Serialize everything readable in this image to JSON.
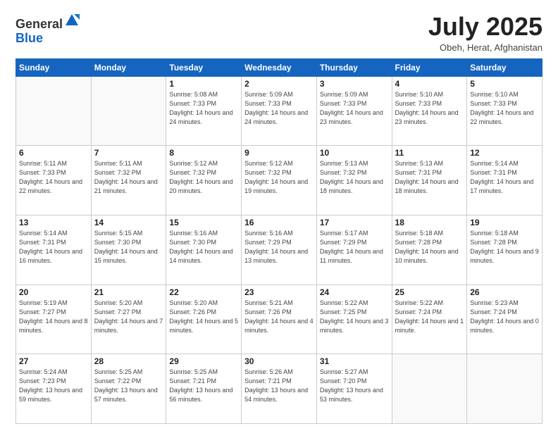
{
  "logo": {
    "general": "General",
    "blue": "Blue"
  },
  "title": "July 2025",
  "location": "Obeh, Herat, Afghanistan",
  "days_of_week": [
    "Sunday",
    "Monday",
    "Tuesday",
    "Wednesday",
    "Thursday",
    "Friday",
    "Saturday"
  ],
  "weeks": [
    [
      {
        "day": "",
        "sunrise": "",
        "sunset": "",
        "daylight": ""
      },
      {
        "day": "",
        "sunrise": "",
        "sunset": "",
        "daylight": ""
      },
      {
        "day": "1",
        "sunrise": "Sunrise: 5:08 AM",
        "sunset": "Sunset: 7:33 PM",
        "daylight": "Daylight: 14 hours and 24 minutes."
      },
      {
        "day": "2",
        "sunrise": "Sunrise: 5:09 AM",
        "sunset": "Sunset: 7:33 PM",
        "daylight": "Daylight: 14 hours and 24 minutes."
      },
      {
        "day": "3",
        "sunrise": "Sunrise: 5:09 AM",
        "sunset": "Sunset: 7:33 PM",
        "daylight": "Daylight: 14 hours and 23 minutes."
      },
      {
        "day": "4",
        "sunrise": "Sunrise: 5:10 AM",
        "sunset": "Sunset: 7:33 PM",
        "daylight": "Daylight: 14 hours and 23 minutes."
      },
      {
        "day": "5",
        "sunrise": "Sunrise: 5:10 AM",
        "sunset": "Sunset: 7:33 PM",
        "daylight": "Daylight: 14 hours and 22 minutes."
      }
    ],
    [
      {
        "day": "6",
        "sunrise": "Sunrise: 5:11 AM",
        "sunset": "Sunset: 7:33 PM",
        "daylight": "Daylight: 14 hours and 22 minutes."
      },
      {
        "day": "7",
        "sunrise": "Sunrise: 5:11 AM",
        "sunset": "Sunset: 7:32 PM",
        "daylight": "Daylight: 14 hours and 21 minutes."
      },
      {
        "day": "8",
        "sunrise": "Sunrise: 5:12 AM",
        "sunset": "Sunset: 7:32 PM",
        "daylight": "Daylight: 14 hours and 20 minutes."
      },
      {
        "day": "9",
        "sunrise": "Sunrise: 5:12 AM",
        "sunset": "Sunset: 7:32 PM",
        "daylight": "Daylight: 14 hours and 19 minutes."
      },
      {
        "day": "10",
        "sunrise": "Sunrise: 5:13 AM",
        "sunset": "Sunset: 7:32 PM",
        "daylight": "Daylight: 14 hours and 18 minutes."
      },
      {
        "day": "11",
        "sunrise": "Sunrise: 5:13 AM",
        "sunset": "Sunset: 7:31 PM",
        "daylight": "Daylight: 14 hours and 18 minutes."
      },
      {
        "day": "12",
        "sunrise": "Sunrise: 5:14 AM",
        "sunset": "Sunset: 7:31 PM",
        "daylight": "Daylight: 14 hours and 17 minutes."
      }
    ],
    [
      {
        "day": "13",
        "sunrise": "Sunrise: 5:14 AM",
        "sunset": "Sunset: 7:31 PM",
        "daylight": "Daylight: 14 hours and 16 minutes."
      },
      {
        "day": "14",
        "sunrise": "Sunrise: 5:15 AM",
        "sunset": "Sunset: 7:30 PM",
        "daylight": "Daylight: 14 hours and 15 minutes."
      },
      {
        "day": "15",
        "sunrise": "Sunrise: 5:16 AM",
        "sunset": "Sunset: 7:30 PM",
        "daylight": "Daylight: 14 hours and 14 minutes."
      },
      {
        "day": "16",
        "sunrise": "Sunrise: 5:16 AM",
        "sunset": "Sunset: 7:29 PM",
        "daylight": "Daylight: 14 hours and 13 minutes."
      },
      {
        "day": "17",
        "sunrise": "Sunrise: 5:17 AM",
        "sunset": "Sunset: 7:29 PM",
        "daylight": "Daylight: 14 hours and 11 minutes."
      },
      {
        "day": "18",
        "sunrise": "Sunrise: 5:18 AM",
        "sunset": "Sunset: 7:28 PM",
        "daylight": "Daylight: 14 hours and 10 minutes."
      },
      {
        "day": "19",
        "sunrise": "Sunrise: 5:18 AM",
        "sunset": "Sunset: 7:28 PM",
        "daylight": "Daylight: 14 hours and 9 minutes."
      }
    ],
    [
      {
        "day": "20",
        "sunrise": "Sunrise: 5:19 AM",
        "sunset": "Sunset: 7:27 PM",
        "daylight": "Daylight: 14 hours and 8 minutes."
      },
      {
        "day": "21",
        "sunrise": "Sunrise: 5:20 AM",
        "sunset": "Sunset: 7:27 PM",
        "daylight": "Daylight: 14 hours and 7 minutes."
      },
      {
        "day": "22",
        "sunrise": "Sunrise: 5:20 AM",
        "sunset": "Sunset: 7:26 PM",
        "daylight": "Daylight: 14 hours and 5 minutes."
      },
      {
        "day": "23",
        "sunrise": "Sunrise: 5:21 AM",
        "sunset": "Sunset: 7:26 PM",
        "daylight": "Daylight: 14 hours and 4 minutes."
      },
      {
        "day": "24",
        "sunrise": "Sunrise: 5:22 AM",
        "sunset": "Sunset: 7:25 PM",
        "daylight": "Daylight: 14 hours and 3 minutes."
      },
      {
        "day": "25",
        "sunrise": "Sunrise: 5:22 AM",
        "sunset": "Sunset: 7:24 PM",
        "daylight": "Daylight: 14 hours and 1 minute."
      },
      {
        "day": "26",
        "sunrise": "Sunrise: 5:23 AM",
        "sunset": "Sunset: 7:24 PM",
        "daylight": "Daylight: 14 hours and 0 minutes."
      }
    ],
    [
      {
        "day": "27",
        "sunrise": "Sunrise: 5:24 AM",
        "sunset": "Sunset: 7:23 PM",
        "daylight": "Daylight: 13 hours and 59 minutes."
      },
      {
        "day": "28",
        "sunrise": "Sunrise: 5:25 AM",
        "sunset": "Sunset: 7:22 PM",
        "daylight": "Daylight: 13 hours and 57 minutes."
      },
      {
        "day": "29",
        "sunrise": "Sunrise: 5:25 AM",
        "sunset": "Sunset: 7:21 PM",
        "daylight": "Daylight: 13 hours and 56 minutes."
      },
      {
        "day": "30",
        "sunrise": "Sunrise: 5:26 AM",
        "sunset": "Sunset: 7:21 PM",
        "daylight": "Daylight: 13 hours and 54 minutes."
      },
      {
        "day": "31",
        "sunrise": "Sunrise: 5:27 AM",
        "sunset": "Sunset: 7:20 PM",
        "daylight": "Daylight: 13 hours and 53 minutes."
      },
      {
        "day": "",
        "sunrise": "",
        "sunset": "",
        "daylight": ""
      },
      {
        "day": "",
        "sunrise": "",
        "sunset": "",
        "daylight": ""
      }
    ]
  ]
}
